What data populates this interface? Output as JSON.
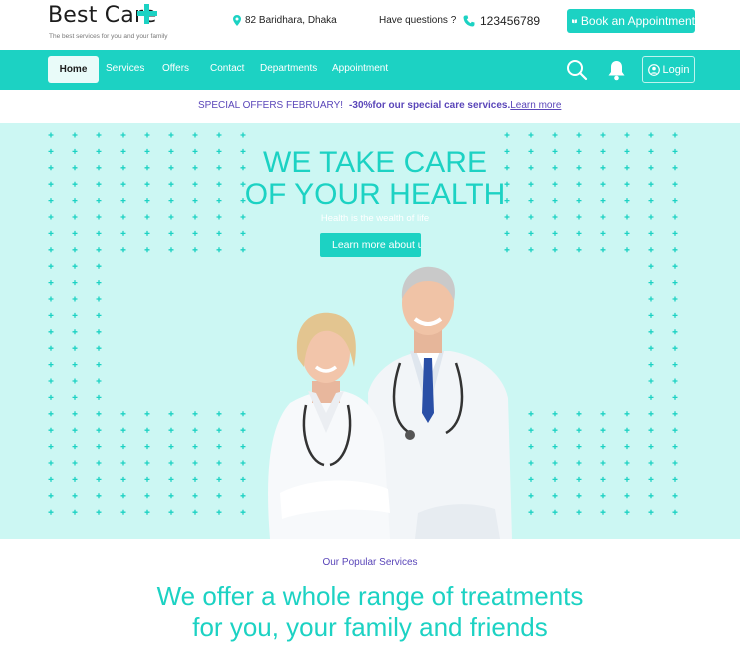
{
  "brand": {
    "name": "Best Care",
    "tagline": "The best services for you and your family",
    "accent_color": "#1cd2c3",
    "secondary_color": "#5a46b9"
  },
  "topbar": {
    "address": "82 Baridhara, Dhaka",
    "address_icon": "map-pin-icon",
    "question": "Have questions ?",
    "phone": "123456789",
    "phone_icon": "phone-icon",
    "book_label": "Book an Appointment",
    "book_icon": "book-icon"
  },
  "nav": {
    "items": [
      {
        "label": "Home",
        "active": true
      },
      {
        "label": "Services"
      },
      {
        "label": "Offers"
      },
      {
        "label": "Contact"
      },
      {
        "label": "Departments"
      },
      {
        "label": "Appointment"
      }
    ],
    "search_icon": "search-icon",
    "bell_icon": "bell-icon",
    "login_label": "Login",
    "login_icon": "user-circle-icon"
  },
  "promo": {
    "text": "SPECIAL OFFERS FEBRUARY!",
    "highlight": "-30%for our special care services.",
    "link": "Learn more"
  },
  "hero": {
    "title_line1": "WE TAKE CARE",
    "title_line2": "OF YOUR HEALTH",
    "subtitle": "Health is the wealth of life",
    "button_label": "Learn more about us"
  },
  "services": {
    "kicker": "Our Popular Services",
    "title_line1": "We offer a whole range of treatments",
    "title_line2": "for you, your family and friends"
  }
}
